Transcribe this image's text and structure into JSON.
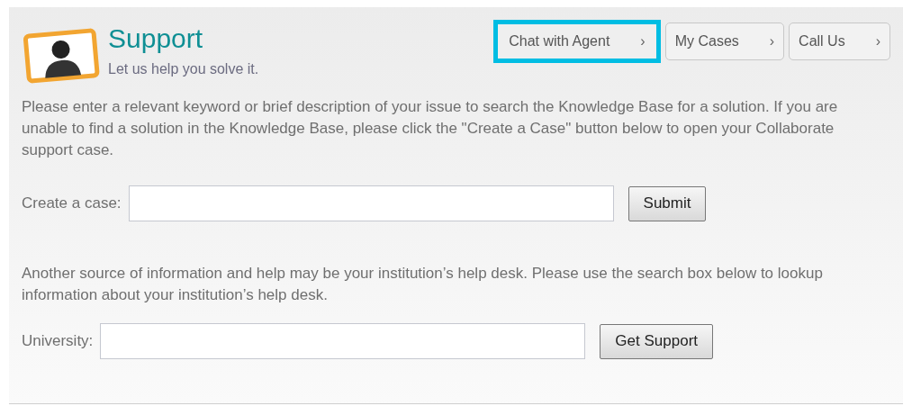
{
  "header": {
    "title": "Support",
    "subtitle": "Let us help you solve it."
  },
  "nav": [
    {
      "label": "Chat with Agent",
      "chevron": "›",
      "highlighted": true
    },
    {
      "label": "My Cases",
      "chevron": "›",
      "highlighted": false
    },
    {
      "label": "Call Us",
      "chevron": "›",
      "highlighted": false
    }
  ],
  "intro": "Please enter a relevant keyword or brief description of your issue to search the Knowledge Base for a solution. If you are unable to find a solution in the Knowledge Base, please click the \"Create a Case\" button below to open your Collaborate support case.",
  "case_form": {
    "label": "Create a case:",
    "button": "Submit"
  },
  "helpdesk_text": "Another source of information and help may be your institution’s help desk. Please use the search box below to lookup information about your institution’s help desk.",
  "university_form": {
    "label": "University:",
    "button": "Get Support"
  }
}
